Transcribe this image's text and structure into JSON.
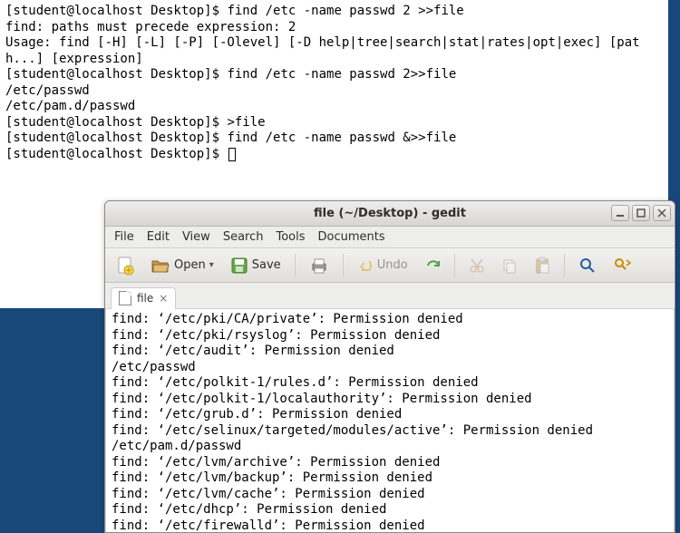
{
  "terminal": {
    "prompt": "[student@localhost Desktop]$ ",
    "lines": [
      {
        "prompt": true,
        "cmd": "find /etc -name passwd 2 >>file"
      },
      {
        "text": "find: paths must precede expression: 2"
      },
      {
        "text": "Usage: find [-H] [-L] [-P] [-Olevel] [-D help|tree|search|stat|rates|opt|exec] [path...] [expression]"
      },
      {
        "prompt": true,
        "cmd": "find /etc -name passwd 2>>file"
      },
      {
        "text": "/etc/passwd"
      },
      {
        "text": "/etc/pam.d/passwd"
      },
      {
        "prompt": true,
        "cmd": ">file"
      },
      {
        "prompt": true,
        "cmd": "find /etc -name passwd &>>file"
      },
      {
        "prompt": true,
        "cmd": "",
        "cursor": true
      }
    ]
  },
  "gedit": {
    "title": "file (~/Desktop) - gedit",
    "menu": [
      "File",
      "Edit",
      "View",
      "Search",
      "Tools",
      "Documents"
    ],
    "toolbar": {
      "new": "New",
      "open": "Open",
      "save": "Save",
      "print": "Print",
      "undo": "Undo",
      "redo": "Redo",
      "cut": "Cut",
      "copy": "Copy",
      "paste": "Paste",
      "find": "Find",
      "replace": "Replace"
    },
    "tab_label": "file",
    "content": [
      "find: ‘/etc/pki/CA/private’: Permission denied",
      "find: ‘/etc/pki/rsyslog’: Permission denied",
      "find: ‘/etc/audit’: Permission denied",
      "/etc/passwd",
      "find: ‘/etc/polkit-1/rules.d’: Permission denied",
      "find: ‘/etc/polkit-1/localauthority’: Permission denied",
      "find: ‘/etc/grub.d’: Permission denied",
      "find: ‘/etc/selinux/targeted/modules/active’: Permission denied",
      "/etc/pam.d/passwd",
      "find: ‘/etc/lvm/archive’: Permission denied",
      "find: ‘/etc/lvm/backup’: Permission denied",
      "find: ‘/etc/lvm/cache’: Permission denied",
      "find: ‘/etc/dhcp’: Permission denied",
      "find: ‘/etc/firewalld’: Permission denied"
    ]
  }
}
